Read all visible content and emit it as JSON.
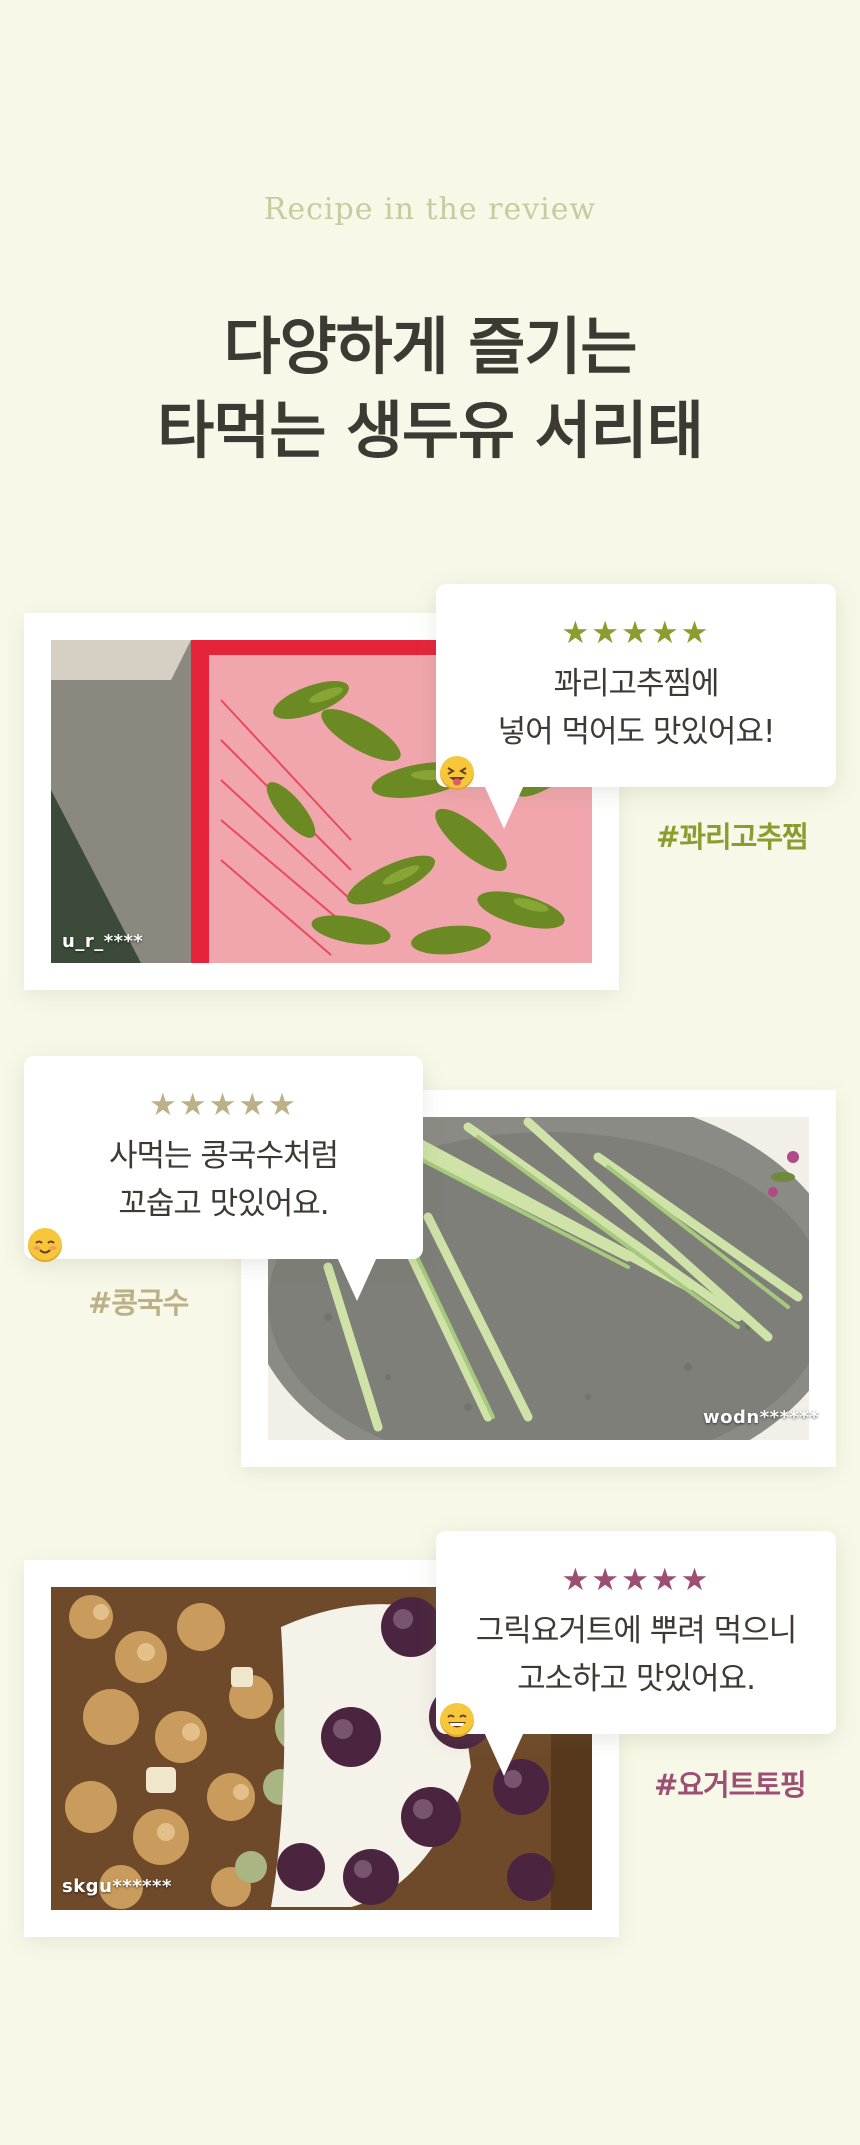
{
  "header": {
    "eyebrow": "Recipe in the review",
    "title_line1": "다양하게 즐기는",
    "title_line2": "타먹는 생두유 서리태"
  },
  "reviews": [
    {
      "stars": "★★★★★",
      "text_line1": "꽈리고추찜에",
      "text_line2": "넣어 먹어도 맛있어요!",
      "emoji": "squinting-tongue-face-icon",
      "hashtag": "#꽈리고추찜",
      "username": "u_r_****",
      "accent_color": "#8e9b2e"
    },
    {
      "stars": "★★★★★",
      "text_line1": "사먹는 콩국수처럼",
      "text_line2": "꼬숩고 맛있어요.",
      "emoji": "smiling-blush-face-icon",
      "hashtag": "#콩국수",
      "username": "wodn******",
      "accent_color": "#bcb088"
    },
    {
      "stars": "★★★★★",
      "text_line1": "그릭요거트에 뿌려 먹으니",
      "text_line2": "고소하고 맛있어요.",
      "emoji": "grinning-face-icon",
      "hashtag": "#요거트토핑",
      "username": "skgu******",
      "accent_color": "#9d4f73"
    }
  ]
}
